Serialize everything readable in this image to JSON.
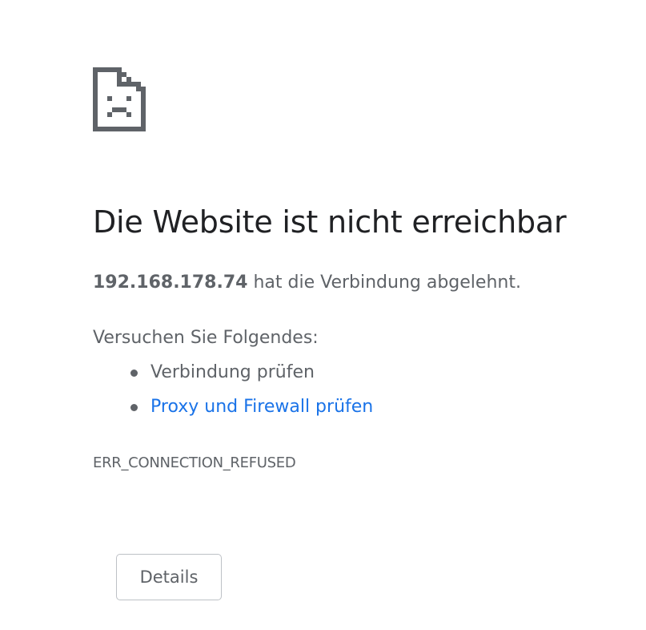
{
  "error": {
    "icon": "sad-document-icon",
    "heading": "Die Website ist nicht erreichbar",
    "summary": {
      "host": "192.168.178.74",
      "message": " hat die Verbindung abgelehnt."
    },
    "suggestions": {
      "title": "Versuchen Sie Folgendes:",
      "items": [
        {
          "label": "Verbindung prüfen",
          "link": false
        },
        {
          "label": "Proxy und Firewall prüfen",
          "link": true
        }
      ]
    },
    "code": "ERR_CONNECTION_REFUSED"
  },
  "buttons": {
    "details_label": "Details"
  },
  "colors": {
    "heading": "#202124",
    "text": "#5f6368",
    "link": "#1a73e8",
    "icon": "#5f6368",
    "button_border": "#bdc1c6"
  }
}
